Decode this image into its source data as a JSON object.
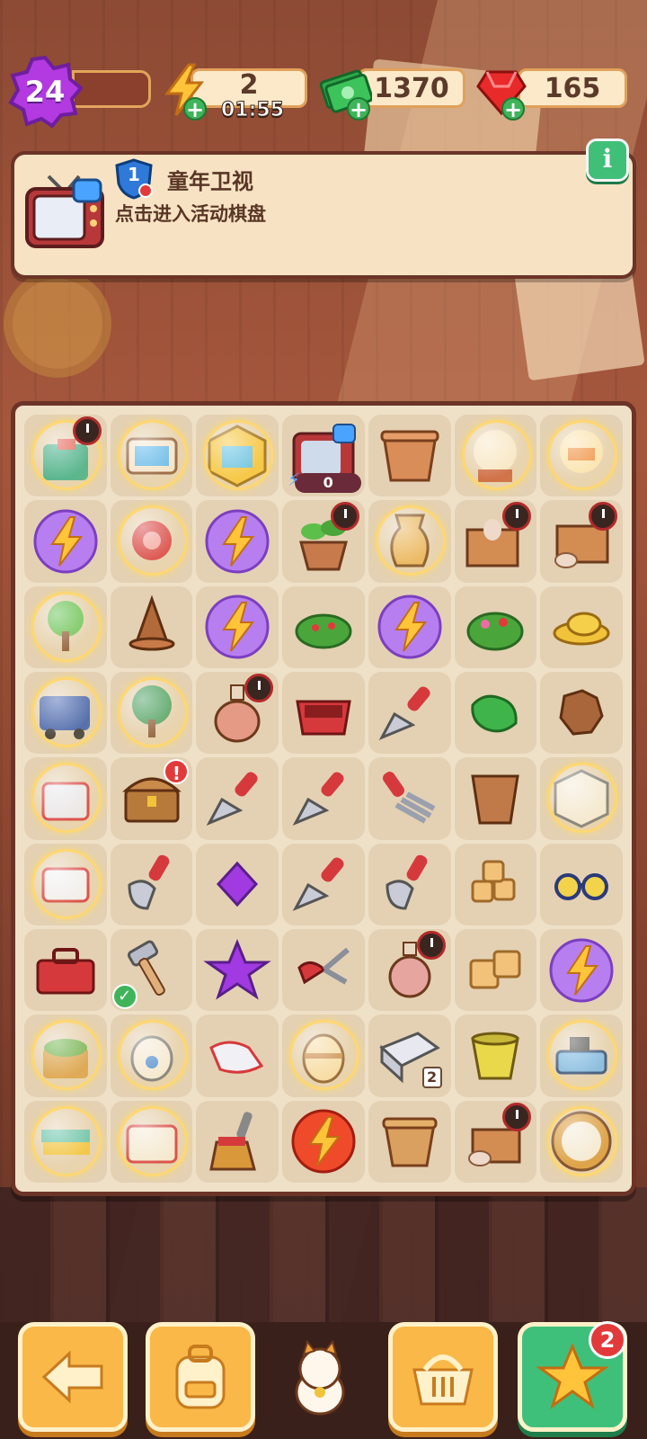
{
  "hud": {
    "level": "24",
    "energy": "2",
    "energy_timer": "01:55",
    "cash": "1370",
    "gems": "165"
  },
  "event": {
    "rank": "1",
    "title": "童年卫视",
    "subtitle": "点击进入活动棋盘",
    "info_label": "i"
  },
  "board": {
    "tv_energy_count": "0",
    "chest_alert": "!",
    "stamp_level": "2"
  },
  "bottom": {
    "starred_count": "2"
  },
  "colors": {
    "board_bg": "#efe0c8",
    "cell_bg": "#e4d1b3",
    "frame": "#6b3427",
    "accent_orange": "#f9b848",
    "accent_green": "#3fc07a",
    "badge_red": "#e23a3a"
  },
  "icons": [
    "level-star-icon",
    "lightning-icon",
    "cash-stack-icon",
    "ruby-gem-icon",
    "plus-icon",
    "tv-icon",
    "shield-icon",
    "info-icon",
    "back-arrow-icon",
    "backpack-icon",
    "lucky-cat-icon",
    "basket-icon",
    "star-icon"
  ]
}
